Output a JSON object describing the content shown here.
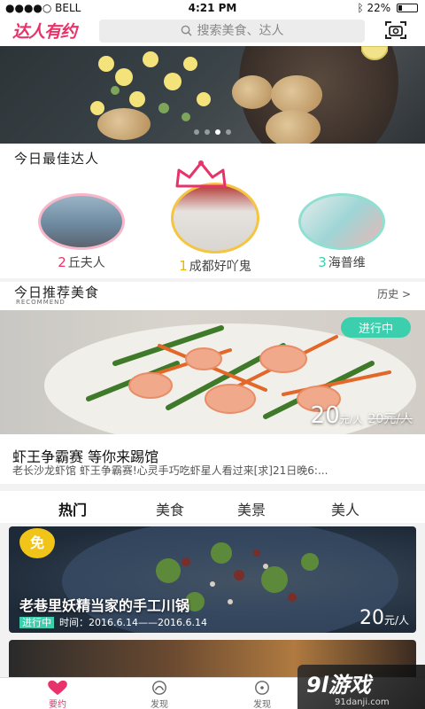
{
  "status_bar": {
    "carrier": "●●●●○ BELL",
    "time": "4:21 PM",
    "battery": "22%",
    "battery_level": 0.22
  },
  "header": {
    "logo_text": "达人有约",
    "search_placeholder": "搜索美食、达人",
    "brand_color": "#e8336a"
  },
  "banner": {
    "page_count": 4,
    "active_page": 2
  },
  "experts": {
    "title": "今日最佳达人",
    "items": [
      {
        "rank": "2",
        "name": "丘夫人",
        "rank_color": "#e8336a",
        "ring_color": "#f7b7c8"
      },
      {
        "rank": "1",
        "name": "成都好吖鬼",
        "rank_color": "#f0b400",
        "ring_color": "#f5c542"
      },
      {
        "rank": "3",
        "name": "海普维",
        "rank_color": "#3ccfae",
        "ring_color": "#8fe0d0"
      }
    ]
  },
  "recommend": {
    "title": "今日推荐美食",
    "subtitle": "RECOMMEND",
    "history_label": "历史 >",
    "status_tag": "进行中",
    "price": "20",
    "price_unit": "元/人",
    "old_price": "20元/人",
    "name": "虾王争霸赛 等你来踢馆",
    "description": "老长沙龙虾馆 虾王争霸赛!心灵手巧吃虾星人看过来[求]21日晚6:..."
  },
  "tabs": [
    {
      "label": "热门",
      "active": true
    },
    {
      "label": "美食",
      "active": false
    },
    {
      "label": "美景",
      "active": false
    },
    {
      "label": "美人",
      "active": false
    }
  ],
  "feed": [
    {
      "badge": "免",
      "title": "老巷里妖精当家的手工川锅",
      "status": "进行中",
      "time_label": "时间：2016.6.14——2016.6.14",
      "price": "20",
      "price_unit": "元/人"
    }
  ],
  "bottom_nav": [
    {
      "label": "要约",
      "icon": "heart-icon",
      "active": true
    },
    {
      "label": "发现",
      "icon": "discover-icon",
      "active": false
    }
  ],
  "bottom_nav_second": {
    "label": "发现",
    "icon": "discover-icon"
  },
  "bottom_nav_first_alt": {
    "label": "要约",
    "icon": "heart-icon"
  },
  "watermark": {
    "main": "9l游戏",
    "url": "91danji.com"
  }
}
